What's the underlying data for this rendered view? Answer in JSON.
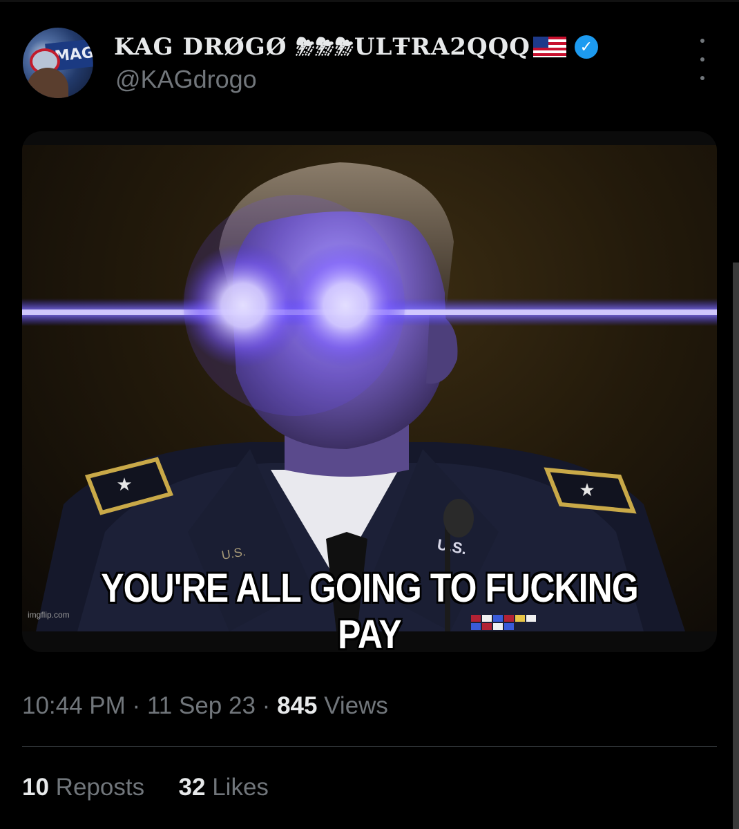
{
  "post": {
    "author": {
      "display_name": "KAG DRØGØ ⛈⛈⛈ULŦRA2QQQ",
      "handle": "@KAGdrogo",
      "avatar_text": "MAGA",
      "verified": true,
      "flag_icon": "us-flag-icon"
    },
    "media": {
      "caption": "YOU'RE ALL GOING TO FUCKING PAY",
      "watermark": "imgflip.com",
      "badge_text": "U.S.",
      "laser_color": "#6a4dff"
    },
    "meta": {
      "time": "10:44 PM",
      "date": "11 Sep 23",
      "separator": "·",
      "views_count": "845",
      "views_label": "Views"
    },
    "stats": {
      "reposts_count": "10",
      "reposts_label": "Reposts",
      "likes_count": "32",
      "likes_label": "Likes"
    },
    "colors": {
      "background": "#000000",
      "primary_text": "#e7e9ea",
      "secondary_text": "#71767b",
      "verified_blue": "#1d9bf0",
      "divider": "#2f3336"
    }
  }
}
